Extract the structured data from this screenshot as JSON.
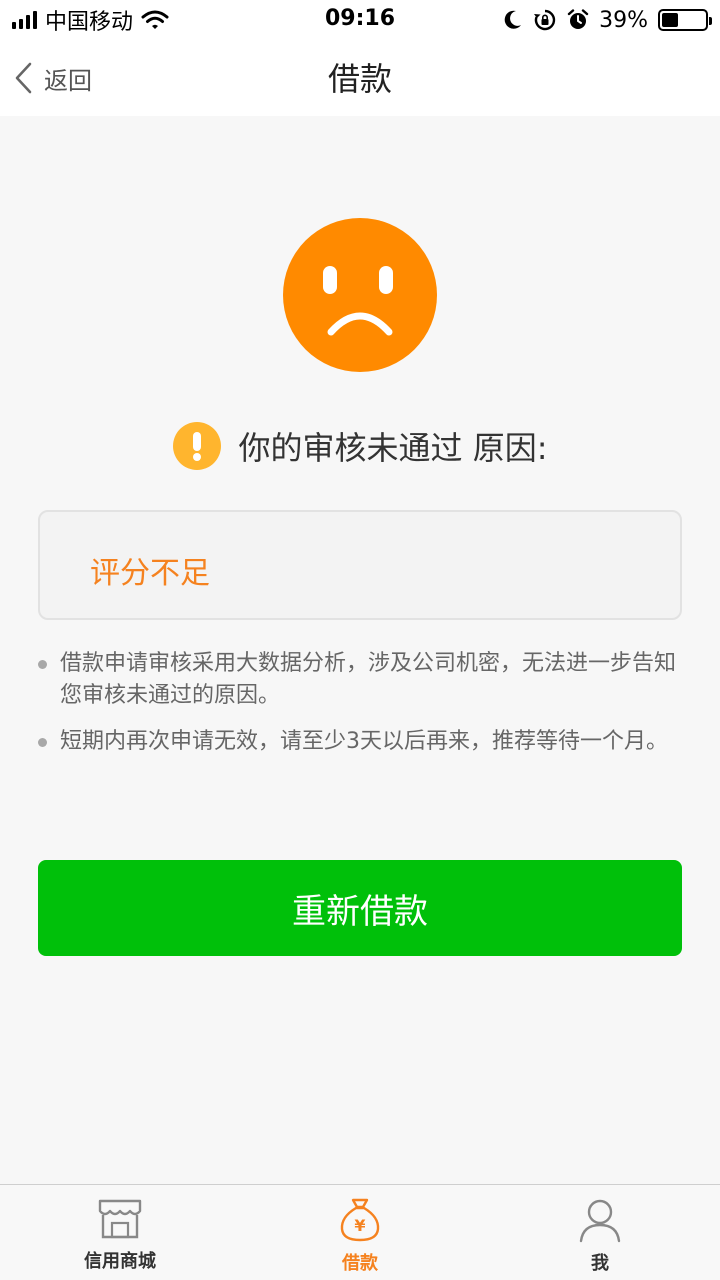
{
  "status_bar": {
    "carrier": "中国移动",
    "time": "09:16",
    "battery_percent": "39%",
    "battery_level": 0.39
  },
  "nav": {
    "back_label": "返回",
    "title": "借款"
  },
  "result": {
    "heading": "你的审核未通过 原因:",
    "reason": "评分不足"
  },
  "notes": [
    "借款申请审核采用大数据分析，涉及公司机密，无法进一步告知您审核未通过的原因。",
    "短期内再次申请无效，请至少3天以后再来，推荐等待一个月。"
  ],
  "action": {
    "reapply_label": "重新借款"
  },
  "tabs": [
    {
      "label": "信用商城",
      "icon": "store-icon",
      "active": false
    },
    {
      "label": "借款",
      "icon": "money-bag-icon",
      "active": true
    },
    {
      "label": "我",
      "icon": "user-icon",
      "active": false
    }
  ],
  "colors": {
    "accent_orange": "#f5821f",
    "face_orange": "#ff8a00",
    "warning_yellow": "#ffb52e",
    "button_green": "#00c00a"
  }
}
